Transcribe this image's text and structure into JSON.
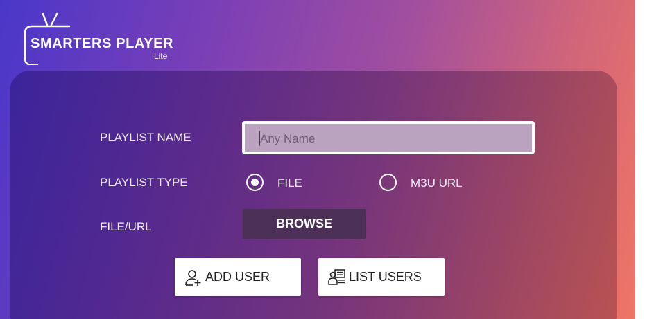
{
  "logo": {
    "title": "SMARTERS PLAYER",
    "subtitle": "Lite"
  },
  "form": {
    "playlist_name_label": "PLAYLIST NAME",
    "playlist_name_placeholder": "Any Name",
    "playlist_type_label": "PLAYLIST TYPE",
    "type_options": [
      {
        "label": "FILE",
        "selected": true
      },
      {
        "label": "M3U URL",
        "selected": false
      }
    ],
    "file_url_label": "FILE/URL",
    "browse_label": "BROWSE"
  },
  "actions": {
    "add_user_label": "ADD USER",
    "list_users_label": "LIST USERS"
  },
  "icons": {
    "logo": "tv-antenna-icon",
    "add_user": "add-user-icon",
    "list_users": "list-users-icon"
  },
  "colors": {
    "gradient_start": "#4a37c9",
    "gradient_end": "#ef7565",
    "browse_bg": "#4c3058",
    "input_bg": "#b9a3be"
  }
}
